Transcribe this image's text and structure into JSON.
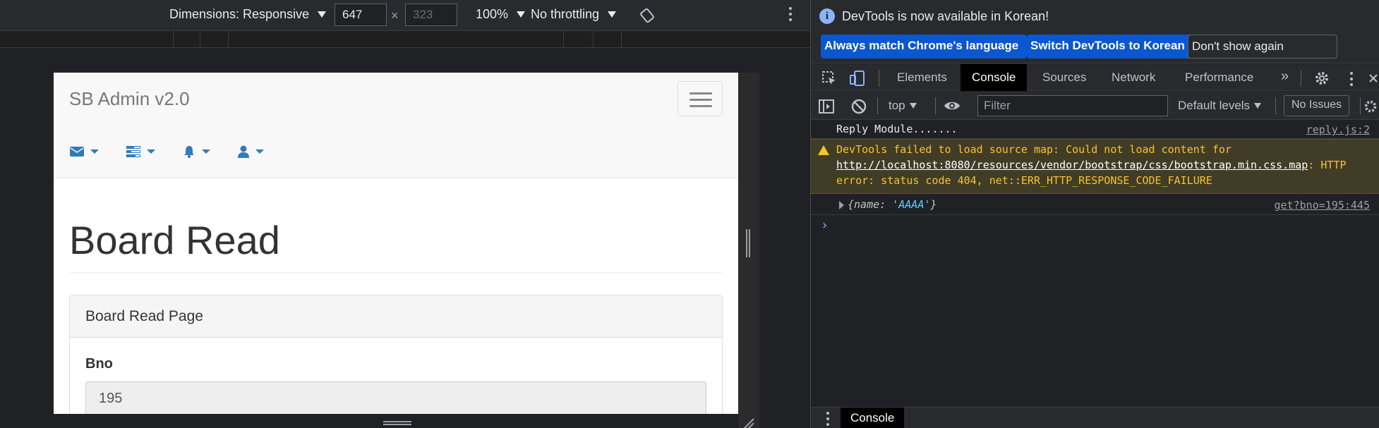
{
  "emulation": {
    "dimensions_label": "Dimensions: Responsive",
    "width_value": "647",
    "times": "×",
    "height_value": "323",
    "zoom": "100%",
    "throttling": "No throttling"
  },
  "page": {
    "brand": "SB Admin v2.0",
    "nav_icons": [
      "envelope-icon",
      "tasks-icon",
      "bell-icon",
      "user-icon"
    ],
    "title": "Board Read",
    "panel_heading": "Board Read Page",
    "bno_label": "Bno",
    "bno_value": "195",
    "link_color": "#337ab7"
  },
  "devtools": {
    "info_message": "DevTools is now available in Korean!",
    "info_buttons": {
      "match": "Always match Chrome's language",
      "switch": "Switch DevTools to Korean",
      "dismiss": "Don't show again"
    },
    "tabs": [
      "Elements",
      "Console",
      "Sources",
      "Network",
      "Performance"
    ],
    "active_tab": "Console",
    "more_tabs": "»",
    "console_toolbar": {
      "context": "top",
      "filter_placeholder": "Filter",
      "levels": "Default levels",
      "issues": "No Issues"
    },
    "messages": {
      "log1": {
        "text": "Reply Module.......",
        "source": "reply.js:2"
      },
      "warning": {
        "prefix": "DevTools failed to load source map: Could not load content for ",
        "link_part1": "http://localho",
        "link_part2": "st:8080/resources/vendor/bootstrap/css/bootstrap.min.css.map",
        "suffix": ": HTTP error: status code 404, net::ERR_HTTP_RESPONSE_CODE_FAILURE"
      },
      "obj": {
        "open": "{",
        "key": "name: ",
        "value": "'AAAA'",
        "close": "}",
        "source": "get?bno=195:445"
      }
    },
    "prompt": "›",
    "drawer_tab": "Console"
  }
}
